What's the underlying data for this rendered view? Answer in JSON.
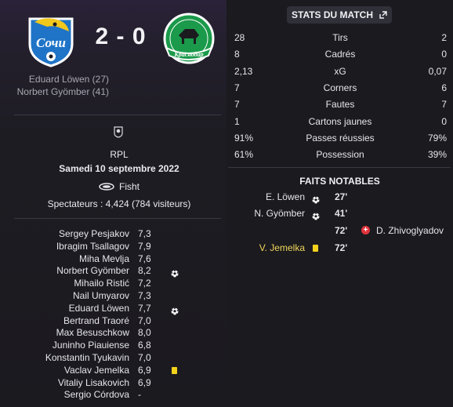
{
  "match": {
    "score": "2 - 0",
    "scorers": [
      "Eduard Löwen (27)",
      "Norbert Gyömber (41)"
    ],
    "competition": "RPL",
    "date": "Samedi 10 septembre 2022",
    "stadium": "Fisht",
    "attendance": "Spectateurs : 4,424 (784 visiteurs)"
  },
  "home_crest": {
    "text": "Сочи",
    "icon": "sochi-crest-icon",
    "color": "#1f74c8"
  },
  "away_crest": {
    "text": "Краснодар",
    "icon": "krasnodar-crest-icon",
    "color": "#1a9a4a"
  },
  "players": [
    {
      "name": "Sergey Pesjakov",
      "rating": "7,3",
      "event": ""
    },
    {
      "name": "Ibragim Tsallagov",
      "rating": "7,9",
      "event": ""
    },
    {
      "name": "Miha Mevlja",
      "rating": "7,6",
      "event": ""
    },
    {
      "name": "Norbert Gyömber",
      "rating": "8,2",
      "event": "goal"
    },
    {
      "name": "Mihailo Ristić",
      "rating": "7,2",
      "event": ""
    },
    {
      "name": "Nail Umyarov",
      "rating": "7,3",
      "event": ""
    },
    {
      "name": "Eduard Löwen",
      "rating": "7,7",
      "event": "goal"
    },
    {
      "name": "Bertrand Traoré",
      "rating": "7,0",
      "event": ""
    },
    {
      "name": "Max Besuschkow",
      "rating": "8,0",
      "event": ""
    },
    {
      "name": "Juninho Piauiense",
      "rating": "6,8",
      "event": ""
    },
    {
      "name": "Konstantin Tyukavin",
      "rating": "7,0",
      "event": ""
    },
    {
      "name": "Vaclav Jemelka",
      "rating": "6,9",
      "event": "yellow-card"
    },
    {
      "name": "Vitaliy Lisakovich",
      "rating": "6,9",
      "event": ""
    },
    {
      "name": "Sergio Córdova",
      "rating": "-",
      "event": ""
    }
  ],
  "stats_title": "STATS DU MATCH",
  "stats": [
    {
      "home": "28",
      "label": "Tirs",
      "away": "2"
    },
    {
      "home": "8",
      "label": "Cadrés",
      "away": "0"
    },
    {
      "home": "2,13",
      "label": "xG",
      "away": "0,07"
    },
    {
      "home": "7",
      "label": "Corners",
      "away": "6"
    },
    {
      "home": "7",
      "label": "Fautes",
      "away": "7"
    },
    {
      "home": "1",
      "label": "Cartons jaunes",
      "away": "0"
    },
    {
      "home": "91%",
      "label": "Passes réussies",
      "away": "79%"
    },
    {
      "home": "61%",
      "label": "Possession",
      "away": "39%"
    }
  ],
  "events_title": "FAITS NOTABLES",
  "events": [
    {
      "side": "home",
      "player": "E. Löwen",
      "type": "goal",
      "minute": "27'"
    },
    {
      "side": "home",
      "player": "N. Gyömber",
      "type": "goal",
      "minute": "41'"
    },
    {
      "side": "away",
      "player": "D. Zhivoglyadov",
      "type": "red-injury",
      "minute": "72'"
    },
    {
      "side": "home",
      "player": "V. Jemelka",
      "type": "yellow-card",
      "minute": "72'"
    }
  ],
  "colors": {
    "yellow_card": "#f2d21b",
    "highlight_text": "#f0d75a",
    "red_icon": "#e0343c"
  }
}
